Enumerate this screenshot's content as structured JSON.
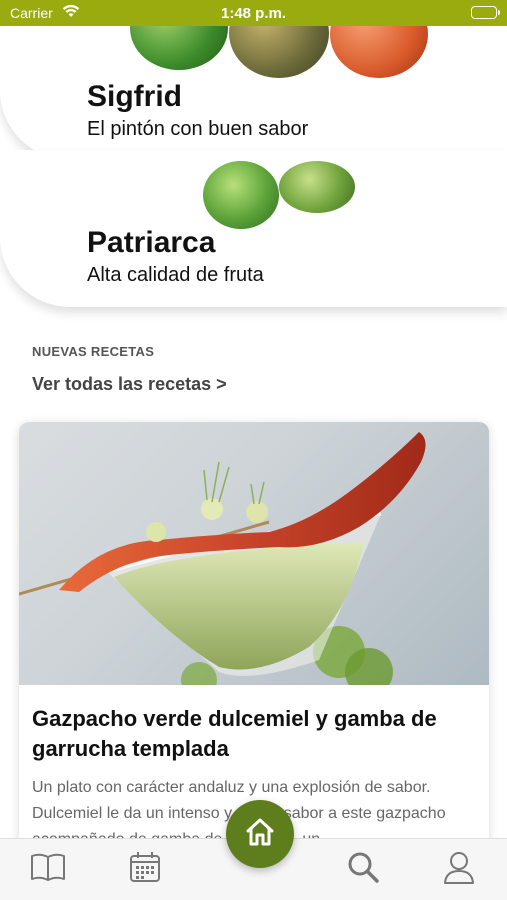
{
  "status_bar": {
    "carrier": "Carrier",
    "time": "1:48 p.m."
  },
  "varieties": [
    {
      "name": "Sigfrid",
      "tagline": "El pintón con buen sabor"
    },
    {
      "name": "Patriarca",
      "tagline": "Alta calidad de fruta"
    }
  ],
  "recipes_section": {
    "label": "NUEVAS RECETAS",
    "see_all": "Ver todas las recetas >"
  },
  "recipe": {
    "title": "Gazpacho verde dulcemiel y gamba de garrucha templada",
    "description": "Un plato con carácter andaluz y una explosión de sabor. Dulcemiel le da un intenso y suave sabor a este gazpacho acompañado de gamba de Garrucha, un"
  },
  "tab_bar": {
    "items": [
      "book-icon",
      "calendar-icon",
      "home-icon",
      "search-icon",
      "profile-icon"
    ],
    "active_color": "#5e7d1d",
    "icon_color": "#777777"
  },
  "colors": {
    "status_bar": "#9aab10",
    "accent": "#5e7d1d"
  }
}
